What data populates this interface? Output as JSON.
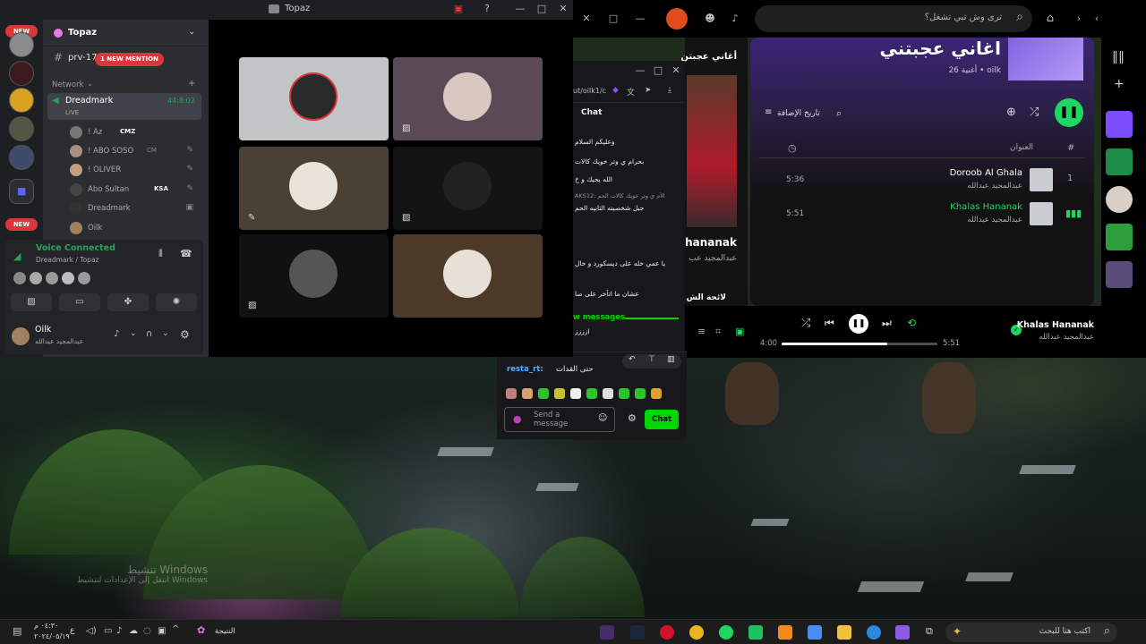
{
  "discord": {
    "window_title": "Topaz",
    "server_name": "Topaz",
    "channel_name": "prv-17",
    "mention_badge": "1 NEW MENTION",
    "new_badge": "NEW",
    "category": "Network",
    "voice_channel": {
      "name": "Dreadmark",
      "timer": "44:8:02",
      "status": "LIVE"
    },
    "members": [
      {
        "name": "! Az",
        "tag": "CMZ"
      },
      {
        "name": "! ABO SOSO",
        "tag": "CM"
      },
      {
        "name": "! OLIVER",
        "tag": ""
      },
      {
        "name": "Abo Sultan",
        "tag": "KSA"
      },
      {
        "name": "Dreadmark",
        "tag": ""
      },
      {
        "name": "Oilk",
        "tag": ""
      }
    ],
    "voice_status": "Voice Connected",
    "voice_location": "Dreadmark / Topaz",
    "user": {
      "name": "Oilk",
      "status": "عبدالمجيد عبدالله"
    }
  },
  "twitch": {
    "url_fragment": "ut/oilk1/c",
    "chat_header": "Chat",
    "messages": [
      "وعليكم السلام",
      "بحرام ي وتر خويك كالات",
      "الله يحيك و خ",
      "AKS12: الأم ي وتر خويك كالات الحم",
      "جبل شخصيته الثانيه الحم",
      "يا عمي خله على ديسكورد و خال",
      "عشان ما اتأخر على صا",
      "ازززز"
    ],
    "new_messages": "w messages",
    "popup_user": "resta_rt:",
    "popup_text": "حتى القدات",
    "send_placeholder": "Send a message",
    "chat_button": "Chat"
  },
  "spotify": {
    "search_placeholder": "ترى وش تبي تشغل؟",
    "playlist_title": "اغاني عجبتني",
    "playlist_meta": "26 أغنية • oilk",
    "left_title": "أغاني عجبتن",
    "left_art_text": "hananak",
    "left_art_sub": "عبدالمجيد عب",
    "left_bottom": "لائحة الش",
    "sort_label": "تاريخ الإضافة",
    "col_hash": "#",
    "col_title": "العنوان",
    "tracks": [
      {
        "num": "1",
        "title": "Doroob Al Ghala",
        "artist": "عبدالمجيد عبدالله",
        "duration": "5:36"
      },
      {
        "num": "",
        "title": "Khalas Hananak",
        "artist": "عبدالمجيد عبدالله",
        "duration": "5:51"
      }
    ],
    "now_playing": {
      "title": "Khalas Hananak",
      "artist": "عبدالمجيد عبدالله",
      "elapsed": "4:00",
      "total": "5:51",
      "progress": 0.68
    },
    "colors": {
      "accent": "#1ed760",
      "playlist_bg": "#3b2576"
    }
  },
  "windows": {
    "watermark_line1": "تنشيط Windows",
    "watermark_line2": "انتقل إلى الإعدادات لتنشيط Windows",
    "taskbar_search": "اكتب هنا للبحث",
    "weather_label": "النتيجة",
    "time": "٠٤:٣٠ م",
    "date": "٢٠٢٤/٠٥/١٩",
    "lang": "ع"
  }
}
